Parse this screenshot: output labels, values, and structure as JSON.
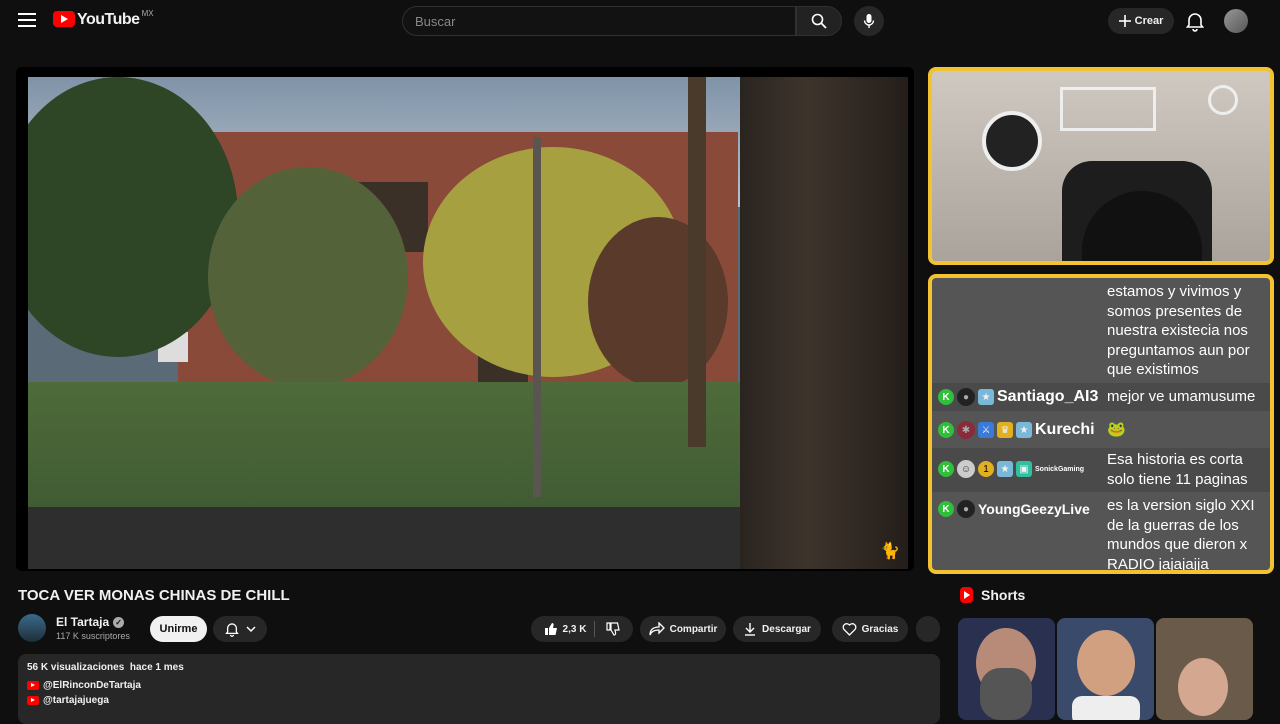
{
  "header": {
    "logo_text": "YouTube",
    "country": "MX",
    "search_placeholder": "Buscar",
    "create_label": "Crear"
  },
  "video": {
    "title": "TOCA VER MONAS CHINAS DE CHILL",
    "watermark": "🐈"
  },
  "channel": {
    "name": "El Tartaja",
    "subscribers": "117 K suscriptores",
    "join_label": "Unirme"
  },
  "actions": {
    "likes": "2,3 K",
    "share_label": "Compartir",
    "download_label": "Descargar",
    "thanks_label": "Gracias"
  },
  "description": {
    "views": "56 K visualizaciones",
    "age": "hace 1 mes",
    "links": [
      "@ElRinconDeTartaja",
      "@tartajajuega"
    ]
  },
  "chat": {
    "messages": [
      {
        "user": "",
        "text": "estamos y vivimos y somos presentes de nuestra existecia nos preguntamos aun por que existimos"
      },
      {
        "user": "Santiago_AI3",
        "text": "mejor ve umamusume"
      },
      {
        "user": "Kurechi",
        "text": "🐸"
      },
      {
        "user": "SonickGaming",
        "text": "Esa historia es corta solo tiene 11 paginas"
      },
      {
        "user": "YoungGeezyLive",
        "text": "es la version siglo XXI de la guerras de los mundos que dieron x RADIO jajajajja"
      }
    ],
    "badge_k": "K",
    "badge_num": "1"
  },
  "shorts": {
    "heading": "Shorts"
  },
  "colors": {
    "accent_border": "#f2c230",
    "brand_red": "#ff0000",
    "badge_green": "#2fbf3a"
  }
}
